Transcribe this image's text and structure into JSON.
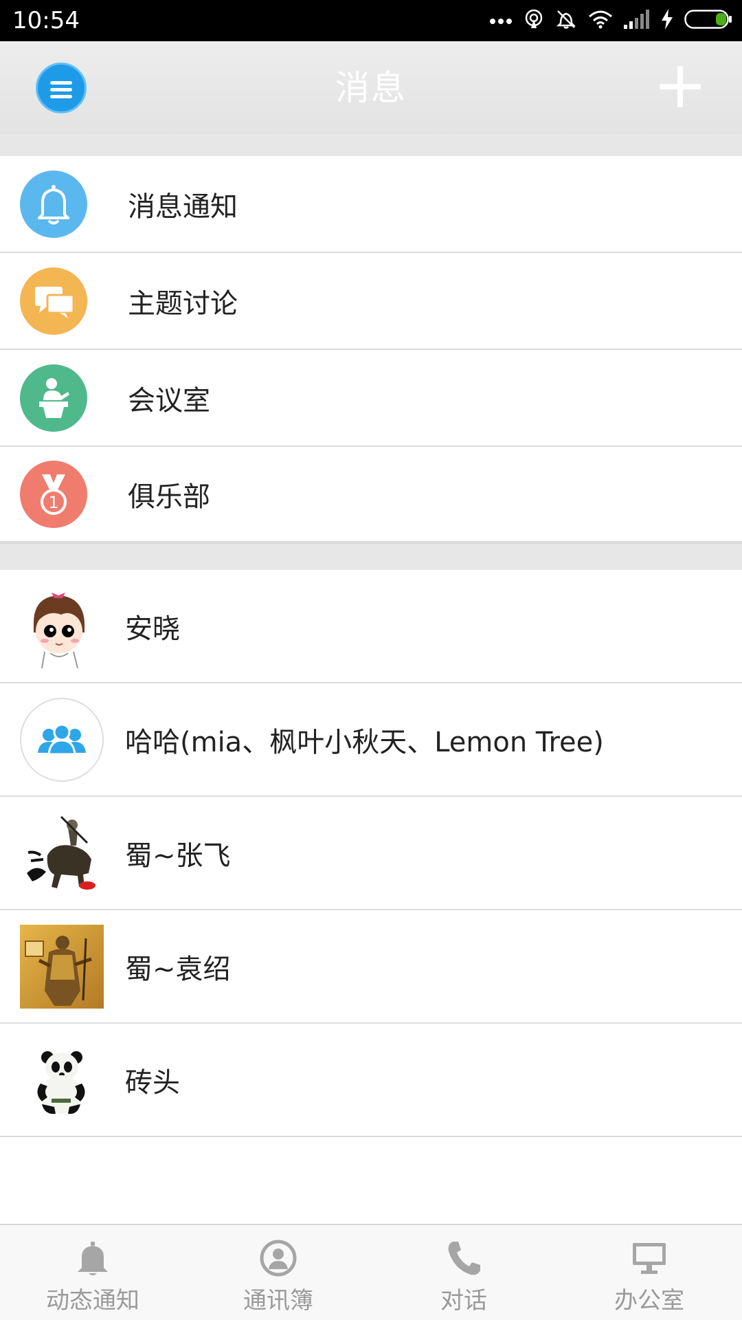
{
  "status_bar": {
    "time": "10:54",
    "icons": [
      "more-dots-icon",
      "hotspot-icon",
      "mute-icon",
      "wifi-icon",
      "signal-icon",
      "charging-icon",
      "battery-icon"
    ]
  },
  "header": {
    "title": "消息",
    "left_icon": "menu-icon",
    "right_icon": "plus-icon",
    "accent_color": "#1e9be8"
  },
  "categories": [
    {
      "label": "消息通知",
      "icon": "bell-icon",
      "color": "#5bb8ef"
    },
    {
      "label": "主题讨论",
      "icon": "chat-bubbles-icon",
      "color": "#f4b553"
    },
    {
      "label": "会议室",
      "icon": "presenter-podium-icon",
      "color": "#4fb98c"
    },
    {
      "label": "俱乐部",
      "icon": "medal-icon",
      "color": "#f07c6e"
    }
  ],
  "conversations": [
    {
      "name": "安晓",
      "avatar": "cartoon-girl-avatar"
    },
    {
      "name": "哈哈(mia、枫叶小秋天、Lemon Tree)",
      "avatar": "group-users-icon"
    },
    {
      "name": "蜀~张飞",
      "avatar": "warrior-on-horse-avatar"
    },
    {
      "name": "蜀~袁绍",
      "avatar": "armored-general-avatar"
    },
    {
      "name": "砖头",
      "avatar": "panda-avatar"
    }
  ],
  "bottom_nav": [
    {
      "label": "动态通知",
      "icon": "bell-icon"
    },
    {
      "label": "通讯簿",
      "icon": "contact-icon"
    },
    {
      "label": "对话",
      "icon": "phone-icon"
    },
    {
      "label": "办公室",
      "icon": "monitor-icon"
    }
  ]
}
